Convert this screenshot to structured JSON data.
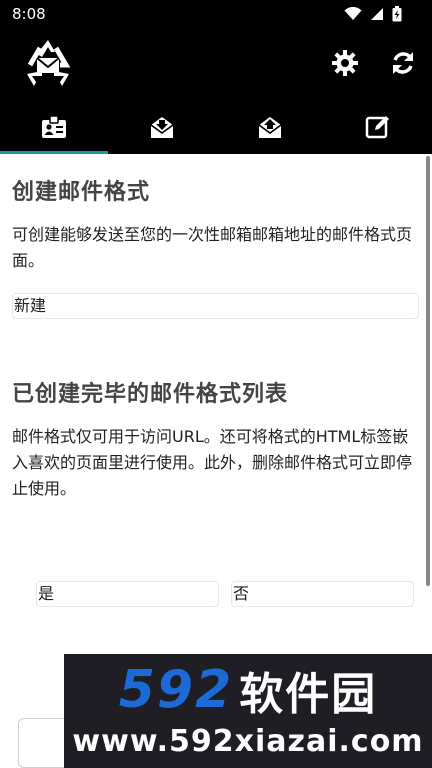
{
  "status_bar": {
    "time": "8:08",
    "icons": [
      "wifi-icon",
      "cellular-signal-icon",
      "battery-charging-icon"
    ]
  },
  "app_bar": {
    "logo": "recycle-mail-logo",
    "actions": [
      "gear-icon",
      "refresh-icon"
    ]
  },
  "tabs": [
    {
      "icon": "contact-card-icon",
      "selected": true
    },
    {
      "icon": "mail-download-icon",
      "selected": false
    },
    {
      "icon": "mail-upload-icon",
      "selected": false
    },
    {
      "icon": "edit-icon",
      "selected": false
    }
  ],
  "section_create": {
    "title": "创建邮件格式",
    "description": "可创建能够发送至您的一次性邮箱邮箱地址的邮件格式页面。",
    "new_field_value": "新建"
  },
  "section_list": {
    "title": "已创建完毕的邮件格式列表",
    "description": "邮件格式仅可用于访问URL。还可将格式的HTML标签嵌入喜欢的页面里进行使用。此外，删除邮件格式可立即停止使用。"
  },
  "confirm": {
    "yes": "是",
    "no": "否"
  },
  "watermark": {
    "number": "592",
    "name": "软件园",
    "url": "www.592xiazai.com"
  },
  "colors": {
    "tab_indicator": "#1a9aa6",
    "watermark_blue": "#1b6ad6",
    "watermark_bg": "#1e1e24"
  }
}
